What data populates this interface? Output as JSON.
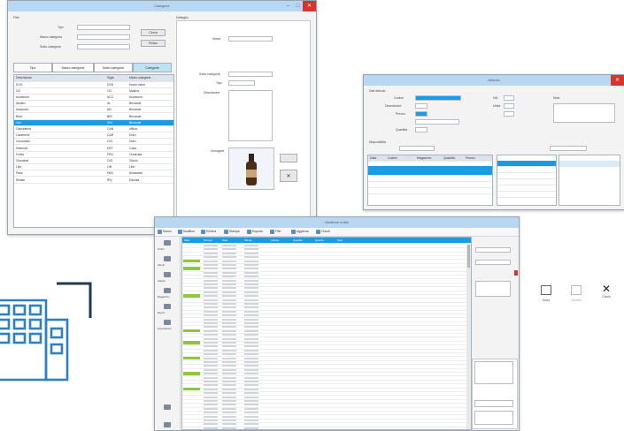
{
  "colors": {
    "titlebar": "#b9d7f0",
    "close": "#d9342b",
    "selection": "#1c9be0",
    "tab_active": "#bfe3f1",
    "row_marker": "#8dc63f",
    "logo_blue": "#2f80c1",
    "logo_dark": "#1f3750"
  },
  "win1": {
    "title": "Categorie",
    "filter": {
      "title": "Filtri",
      "label_tipo": "Tipo",
      "label_macro": "Macro categoria",
      "label_sotto": "Sotto categoria",
      "btn_search": "Cerca",
      "btn_clear": "Pulisci"
    },
    "tabs": [
      "Tipo",
      "Macro categorie",
      "Sotto categorie",
      "Categorie"
    ],
    "grid": {
      "columns": [
        "Descrizione",
        "Sigla",
        "Macro categoria"
      ],
      "rows": [
        [
          "DVD",
          "DVD",
          "Home video"
        ],
        [
          "CD",
          "CD",
          "Musica"
        ],
        [
          "Accessori",
          "ACC",
          "Accessori"
        ],
        [
          "Alcolici",
          "AL",
          "Bevande"
        ],
        [
          "Analcolici",
          "AN",
          "Bevande"
        ],
        [
          "Birre",
          "BIR",
          "Bevande"
        ],
        [
          "Vini",
          "VIN",
          "Bevande"
        ],
        [
          "Cancelleria",
          "CAN",
          "Ufficio"
        ],
        [
          "Caramelle",
          "CAR",
          "Dolci"
        ],
        [
          "Cioccolato",
          "CIO",
          "Dolci"
        ],
        [
          "Detersivi",
          "DET",
          "Casa"
        ],
        [
          "Frutta",
          "FRU",
          "Ortofrutta"
        ],
        [
          "Giocattoli",
          "GIO",
          "Giochi"
        ],
        [
          "Libri",
          "LIB",
          "Libri"
        ],
        [
          "Pane",
          "PAN",
          "Alimentari"
        ],
        [
          "Riviste",
          "RIV",
          "Edicola"
        ]
      ],
      "selected_row": 6
    },
    "detail": {
      "title": "Dettaglio",
      "label_name": "Nome",
      "label_sub": "Sotto categoria",
      "label_type": "Tipo",
      "label_desc": "Descrizione",
      "label_image": "Immagine"
    }
  },
  "win2": {
    "title": "Articolo",
    "section1": "Dati articolo",
    "labels": [
      "Codice",
      "Descrizione",
      "Prezzo",
      "Quantità",
      "IVA",
      "Unità",
      "Note"
    ],
    "section2": "Disponibilità",
    "grid_cols": [
      "Data",
      "Codice",
      "Magazzino",
      "Quantità",
      "Prezzo"
    ],
    "selected_row": 0
  },
  "win3": {
    "title": "Gestione ordini",
    "toolbar": [
      "Nuovo",
      "Modifica",
      "Elimina",
      "Stampa",
      "Esporta",
      "Filtri",
      "Aggiorna",
      "Chiudi"
    ],
    "columns": [
      "Stato",
      "Numero",
      "Data",
      "Cliente",
      "Articolo",
      "Quantità",
      "Importo",
      "Note"
    ],
    "side_items": [
      "Ordini",
      "Clienti",
      "Articoli",
      "Magazzino",
      "Report",
      "Impostazioni"
    ]
  },
  "action_buttons": [
    {
      "label": "Salva",
      "icon": "save-icon"
    },
    {
      "label": "Annulla",
      "icon": "undo-icon"
    },
    {
      "label": "Chiudi",
      "icon": "close-icon"
    }
  ]
}
